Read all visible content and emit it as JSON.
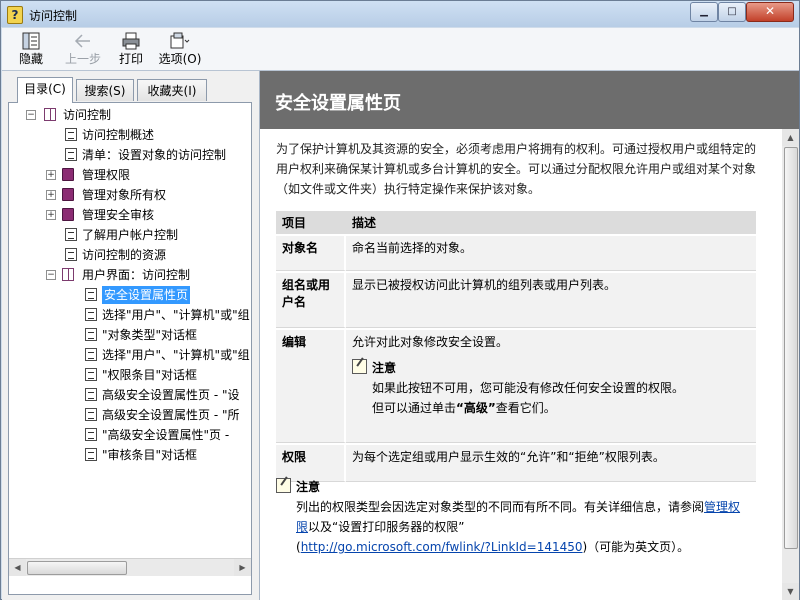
{
  "window": {
    "title": "访问控制",
    "minimize": "▁",
    "maximize": "□",
    "close": "✕"
  },
  "toolbar": {
    "hide_label": "隐藏",
    "back_label": "上一步",
    "print_label": "打印",
    "options_label": "选项(O)",
    "icons": {
      "hide": "panel-hide-icon",
      "back": "back-arrow-icon",
      "print": "printer-icon",
      "options": "options-icon"
    }
  },
  "tabs": [
    {
      "label": "目录(C)",
      "active": true
    },
    {
      "label": "搜索(S)",
      "active": false
    },
    {
      "label": "收藏夹(I)",
      "active": false
    }
  ],
  "tree": [
    {
      "label": "访问控制",
      "icon": "book-open",
      "expander": "−"
    },
    {
      "label": "访问控制概述",
      "icon": "page"
    },
    {
      "label": "清单：设置对象的访问控制",
      "icon": "page"
    },
    {
      "label": "管理权限",
      "icon": "book",
      "expander": "+"
    },
    {
      "label": "管理对象所有权",
      "icon": "book",
      "expander": "+"
    },
    {
      "label": "管理安全审核",
      "icon": "book",
      "expander": "+"
    },
    {
      "label": "了解用户帐户控制",
      "icon": "page"
    },
    {
      "label": "访问控制的资源",
      "icon": "page"
    },
    {
      "label": "用户界面：访问控制",
      "icon": "book-open",
      "expander": "−"
    },
    {
      "label": "安全设置属性页",
      "icon": "page",
      "selected": true
    },
    {
      "label": "选择\"用户\"、\"计算机\"或\"组",
      "icon": "page"
    },
    {
      "label": "\"对象类型\"对话框",
      "icon": "page"
    },
    {
      "label": "选择\"用户\"、\"计算机\"或\"组",
      "icon": "page"
    },
    {
      "label": "\"权限条目\"对话框",
      "icon": "page"
    },
    {
      "label": "高级安全设置属性页 - \"设",
      "icon": "page"
    },
    {
      "label": "高级安全设置属性页 - \"所",
      "icon": "page"
    },
    {
      "label": "\"高级安全设置属性\"页 -",
      "icon": "page"
    },
    {
      "label": "\"审核条目\"对话框",
      "icon": "page"
    }
  ],
  "content": {
    "title": "安全设置属性页",
    "intro": "为了保护计算机及其资源的安全，必须考虑用户将拥有的权利。可通过授权用户或组特定的用户权利来确保某计算机或多台计算机的安全。可以通过分配权限允许用户或组对某个对象（如文件或文件夹）执行特定操作来保护该对象。",
    "table": {
      "headers": [
        "项目",
        "描述"
      ],
      "rows": [
        {
          "key": "对象名",
          "desc": "命名当前选择的对象。"
        },
        {
          "key": "组名或用户名",
          "desc": "显示已被授权访问此计算机的组列表或用户列表。"
        },
        {
          "key": "编辑",
          "desc": "允许对此对象修改安全设置。",
          "note_title": "注意",
          "note_line1": "如果此按钮不可用，您可能没有修改任何安全设置的权限。",
          "note_line2_pre": "但可以通过单击",
          "note_line2_bold": "“高级”",
          "note_line2_post": "查看它们。"
        },
        {
          "key": "权限",
          "desc": "为每个选定组或用户显示生效的“允许”和“拒绝”权限列表。"
        }
      ]
    },
    "note": {
      "title": "注意",
      "text_pre": "列出的权限类型会因选定对象类型的不同而有所不同。有关详细信息，请参阅",
      "link1": "管理权限",
      "text_mid": "以及“设置打印服务器的权限”",
      "open_paren": "(",
      "link2": "http://go.microsoft.com/fwlink/?LinkId=141450",
      "text_post": ")（可能为英文页）。"
    }
  }
}
